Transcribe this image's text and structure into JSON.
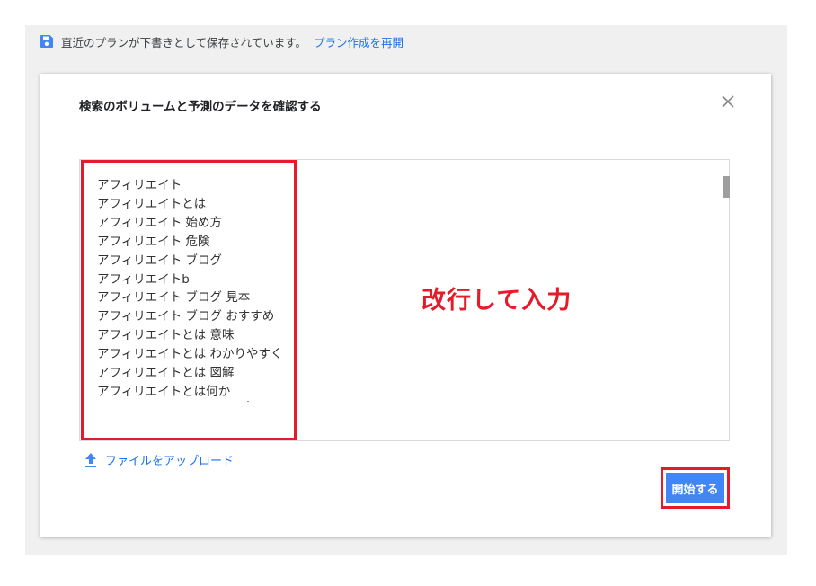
{
  "draft_banner": {
    "message": "直近のプランが下書きとして保存されています。",
    "resume_link": "プラン作成を再開",
    "icon": "save-icon"
  },
  "dialog": {
    "title": "検索のボリュームと予測のデータを確認する",
    "close_icon": "close-icon",
    "keywords": [
      "アフィリエイト",
      "アフィリエイトとは",
      "アフィリエイト 始め方",
      "アフィリエイト 危険",
      "アフィリエイト ブログ",
      "アフィリエイトb",
      "アフィリエイト ブログ 見本",
      "アフィリエイト ブログ おすすめ",
      "アフィリエイトとは 意味",
      "アフィリエイトとは わかりやすく",
      "アフィリエイトとは 図解",
      "アフィリエイトとは何か"
    ],
    "annotation": "改行して入力",
    "upload_link": "ファイルをアップロード",
    "upload_icon": "upload-icon",
    "start_button": "開始する"
  },
  "colors": {
    "accent": "#4285f4",
    "link": "#1a73e8",
    "highlight": "#e51a2a"
  }
}
